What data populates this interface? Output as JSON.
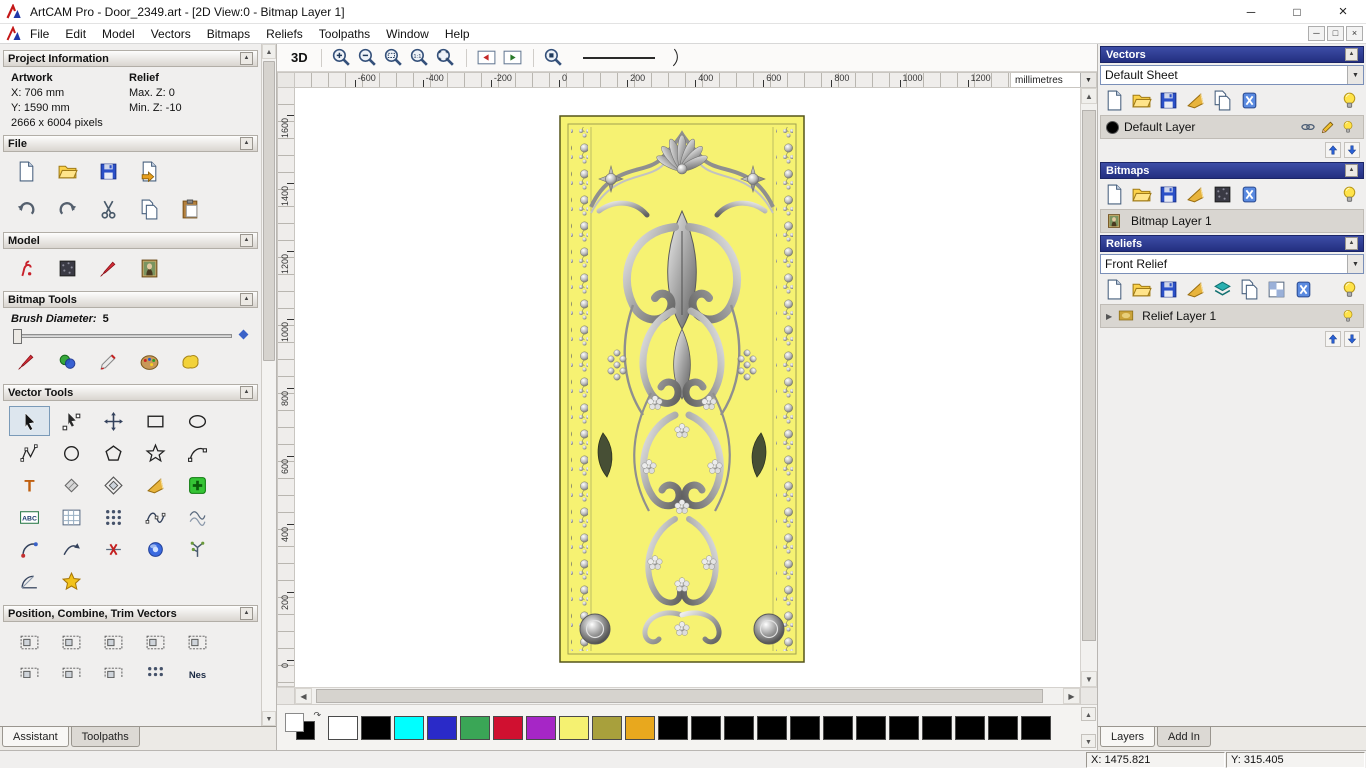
{
  "window": {
    "title": "ArtCAM Pro - Door_2349.art - [2D View:0 - Bitmap Layer 1]",
    "controls": {
      "minimize": "─",
      "maximize": "□",
      "close": "×"
    }
  },
  "mdi_controls": {
    "minimize": "─",
    "restore": "□",
    "close": "×"
  },
  "menus": [
    "File",
    "Edit",
    "Model",
    "Vectors",
    "Bitmaps",
    "Reliefs",
    "Toolpaths",
    "Window",
    "Help"
  ],
  "assistant": {
    "project_info": {
      "header": "Project Information",
      "artwork_title": "Artwork",
      "relief_title": "Relief",
      "x": "X: 706 mm",
      "y": "Y: 1590 mm",
      "pixels": "2666 x 6004 pixels",
      "max_z": "Max. Z: 0",
      "min_z": "Min. Z: -10"
    },
    "file": {
      "header": "File",
      "row1": [
        {
          "name": "new-model-icon",
          "sym": "s-page"
        },
        {
          "name": "open-model-icon",
          "sym": "s-folder"
        },
        {
          "name": "save-model-icon",
          "sym": "s-save"
        },
        {
          "name": "export-model-icon",
          "sym": "s-export"
        }
      ],
      "row2": [
        {
          "name": "undo-icon",
          "sym": "s-undo"
        },
        {
          "name": "redo-icon",
          "sym": "s-redo"
        },
        {
          "name": "cut-icon",
          "sym": "s-cut"
        },
        {
          "name": "copy-icon",
          "sym": "s-copy"
        },
        {
          "name": "paste-icon",
          "sym": "s-paste"
        }
      ]
    },
    "model": {
      "header": "Model",
      "icons": [
        {
          "name": "greyscale-model-icon",
          "sym": "s-redman"
        },
        {
          "name": "invert-model-icon",
          "sym": "s-texture"
        },
        {
          "name": "sculpt-model-icon",
          "sym": "s-brushred"
        },
        {
          "name": "load-bitmap-icon",
          "sym": "s-mona"
        }
      ]
    },
    "bitmap_tools": {
      "header": "Bitmap Tools",
      "label": "Brush Diameter:",
      "value": "5",
      "icons": [
        {
          "name": "paint-icon",
          "sym": "s-brushred"
        },
        {
          "name": "paint-selective-icon",
          "sym": "s-twodots"
        },
        {
          "name": "draw-icon",
          "sym": "s-syringe"
        },
        {
          "name": "colour-palette-icon",
          "sym": "s-palette"
        },
        {
          "name": "flood-fill-icon",
          "sym": "s-sponge"
        }
      ]
    },
    "vector_tools": {
      "header": "Vector Tools",
      "icons": [
        {
          "name": "select-vectors-icon",
          "sym": "s-cursor",
          "pressed": true
        },
        {
          "name": "node-editing-icon",
          "sym": "s-nodeedit"
        },
        {
          "name": "transform-vectors-icon",
          "sym": "s-transform"
        },
        {
          "name": "create-rectangle-icon",
          "sym": "s-rect"
        },
        {
          "name": "create-ellipse-icon",
          "sym": "s-ellipse"
        },
        {
          "name": "create-polyline-icon",
          "sym": "s-poly"
        },
        {
          "name": "create-circle-icon",
          "sym": "s-circle"
        },
        {
          "name": "create-polygon-icon",
          "sym": "s-pentagon"
        },
        {
          "name": "create-star-icon",
          "sym": "s-star"
        },
        {
          "name": "create-arc-icon",
          "sym": "s-arc"
        },
        {
          "name": "create-text-icon",
          "sym": "s-text"
        },
        {
          "name": "measure-icon",
          "sym": "s-measure"
        },
        {
          "name": "offset-vectors-icon",
          "sym": "s-offsetv"
        },
        {
          "name": "fillet-vectors-icon",
          "sym": "s-fillet"
        },
        {
          "name": "paste-vectors-icon",
          "sym": "s-plusgreen"
        },
        {
          "name": "text-block-icon",
          "sym": "s-abc"
        },
        {
          "name": "snap-grid-icon",
          "sym": "s-gridwin"
        },
        {
          "name": "block-copy-icon",
          "sym": "s-dotarray"
        },
        {
          "name": "create-freeform-curve-icon",
          "sym": "s-wavenodes"
        },
        {
          "name": "fit-curves-icon",
          "sym": "s-waves2"
        },
        {
          "name": "close-vector-icon",
          "sym": "s-arcdot"
        },
        {
          "name": "join-vectors-icon",
          "sym": "s-curvearrow"
        },
        {
          "name": "cut-vectors-icon",
          "sym": "s-xpath"
        },
        {
          "name": "create-spin-shape-icon",
          "sym": "s-bluedonut"
        },
        {
          "name": "vector-doctor-icon",
          "sym": "s-branch"
        },
        {
          "name": "slice-vectors-icon",
          "sym": "s-section"
        },
        {
          "name": "wrap-vectors-icon",
          "sym": "s-goldstar"
        }
      ]
    },
    "position": {
      "header": "Position, Combine, Trim Vectors",
      "icons": [
        {
          "name": "align-left-icon",
          "sym": "s-alignbox"
        },
        {
          "name": "align-right-icon",
          "sym": "s-alignbox"
        },
        {
          "name": "align-centre-icon",
          "sym": "s-alignbox"
        },
        {
          "name": "align-bottom-icon",
          "sym": "s-alignbox"
        },
        {
          "name": "align-top-icon",
          "sym": "s-alignbox"
        },
        {
          "name": "combine-vectors-icon",
          "sym": "s-alignbox"
        },
        {
          "name": "trim-vectors-icon",
          "sym": "s-alignbox"
        },
        {
          "name": "weld-vectors-icon",
          "sym": "s-alignbox"
        },
        {
          "name": "block-nest-icon",
          "sym": "s-dotarray"
        },
        {
          "name": "nesting-icon",
          "sym": "s-nes"
        }
      ]
    },
    "tabs": [
      {
        "label": "Assistant",
        "active": true
      },
      {
        "label": "Toolpaths",
        "active": false
      }
    ]
  },
  "canvas": {
    "toolbar": {
      "view_button": "3D",
      "zoom_icons": [
        {
          "name": "zoom-in-icon",
          "sym": "s-zoomin"
        },
        {
          "name": "zoom-out-icon",
          "sym": "s-zoomout"
        },
        {
          "name": "zoom-box-icon",
          "sym": "s-zoomrect"
        },
        {
          "name": "zoom-1to1-icon",
          "sym": "s-zoom11"
        },
        {
          "name": "zoom-fit-icon",
          "sym": "s-zoomfit"
        }
      ],
      "view_icons": [
        {
          "name": "previous-view-icon",
          "sym": "s-viewprev"
        },
        {
          "name": "next-view-icon",
          "sym": "s-viewnext"
        }
      ],
      "extra_icons": [
        {
          "name": "zoom-object-icon",
          "sym": "s-zoomobj"
        }
      ]
    },
    "ruler": {
      "unit": "millimetres",
      "h_ticks": [
        -600,
        -400,
        -200,
        0,
        200,
        400,
        600,
        800,
        1000,
        1200
      ],
      "v_ticks": [
        1600,
        1400,
        1200,
        1000,
        800,
        600,
        400,
        200,
        0
      ]
    },
    "door": {
      "fill": "#f6f272"
    }
  },
  "layers_panel": {
    "vectors": {
      "header": "Vectors",
      "sheet": "Default Sheet",
      "toolbar": [
        {
          "name": "new-vector-layer-icon",
          "sym": "s-page"
        },
        {
          "name": "open-vector-layer-icon",
          "sym": "s-folder"
        },
        {
          "name": "save-vector-layer-icon",
          "sym": "s-save"
        },
        {
          "name": "merge-vector-layers-icon",
          "sym": "s-fillet"
        },
        {
          "name": "copy-vector-layer-icon",
          "sym": "s-copy"
        },
        {
          "name": "delete-vector-layer-icon",
          "sym": "s-delblue"
        },
        {
          "name": "toggle-vectors-visibility-icon",
          "sym": "s-bulb"
        }
      ],
      "layer": "Default Layer",
      "layer_color": "#000000",
      "layer_icons": [
        {
          "name": "layer-snap-icon",
          "sym": "s-link"
        },
        {
          "name": "layer-edit-icon",
          "sym": "s-pencil"
        },
        {
          "name": "layer-visibility-icon",
          "sym": "s-bulb"
        }
      ],
      "reorder": [
        {
          "name": "move-vector-layer-up-icon",
          "sym": "s-arrup"
        },
        {
          "name": "move-vector-layer-down-icon",
          "sym": "s-arrdown"
        }
      ]
    },
    "bitmaps": {
      "header": "Bitmaps",
      "toolbar": [
        {
          "name": "new-bitmap-layer-icon",
          "sym": "s-page"
        },
        {
          "name": "open-bitmap-layer-icon",
          "sym": "s-folder"
        },
        {
          "name": "save-bitmap-layer-icon",
          "sym": "s-save"
        },
        {
          "name": "merge-bitmap-layers-icon",
          "sym": "s-fillet"
        },
        {
          "name": "bitmap-texture-icon",
          "sym": "s-texture"
        },
        {
          "name": "delete-bitmap-layer-icon",
          "sym": "s-delblue"
        },
        {
          "name": "toggle-bitmaps-visibility-icon",
          "sym": "s-bulb"
        }
      ],
      "layer": "Bitmap Layer 1"
    },
    "reliefs": {
      "header": "Reliefs",
      "relief": "Front Relief",
      "toolbar": [
        {
          "name": "new-relief-layer-icon",
          "sym": "s-page"
        },
        {
          "name": "open-relief-layer-icon",
          "sym": "s-folder"
        },
        {
          "name": "save-relief-layer-icon",
          "sym": "s-save"
        },
        {
          "name": "merge-relief-layers-icon",
          "sym": "s-fillet"
        },
        {
          "name": "relief-layers-stack-icon",
          "sym": "s-layers"
        },
        {
          "name": "copy-relief-layer-icon",
          "sym": "s-copy"
        },
        {
          "name": "relief-preview-icon",
          "sym": "s-checker"
        },
        {
          "name": "delete-relief-layer-icon",
          "sym": "s-delblue"
        },
        {
          "name": "toggle-reliefs-visibility-icon",
          "sym": "s-bulb"
        }
      ],
      "layer": "Relief Layer 1",
      "layer_icons": [
        {
          "name": "relief-layer-visibility-icon",
          "sym": "s-bulb"
        }
      ],
      "reorder": [
        {
          "name": "move-relief-layer-up-icon",
          "sym": "s-arrup"
        },
        {
          "name": "move-relief-layer-down-icon",
          "sym": "s-arrdown"
        }
      ]
    },
    "tabs": [
      {
        "label": "Layers",
        "active": true
      },
      {
        "label": "Add In",
        "active": false
      }
    ]
  },
  "palette": {
    "swatches": [
      "#ffffff",
      "#000000",
      "#00ffff",
      "#2a2ac8",
      "#3aa656",
      "#d01030",
      "#a626c6",
      "#f5f171",
      "#a8a03c",
      "#e8a81e",
      "#000000",
      "#000000",
      "#000000",
      "#000000",
      "#000000",
      "#000000",
      "#000000",
      "#000000",
      "#000000",
      "#000000",
      "#000000",
      "#000000"
    ]
  },
  "statusbar": {
    "x": "X: 1475.821",
    "y": "Y: 315.405"
  }
}
